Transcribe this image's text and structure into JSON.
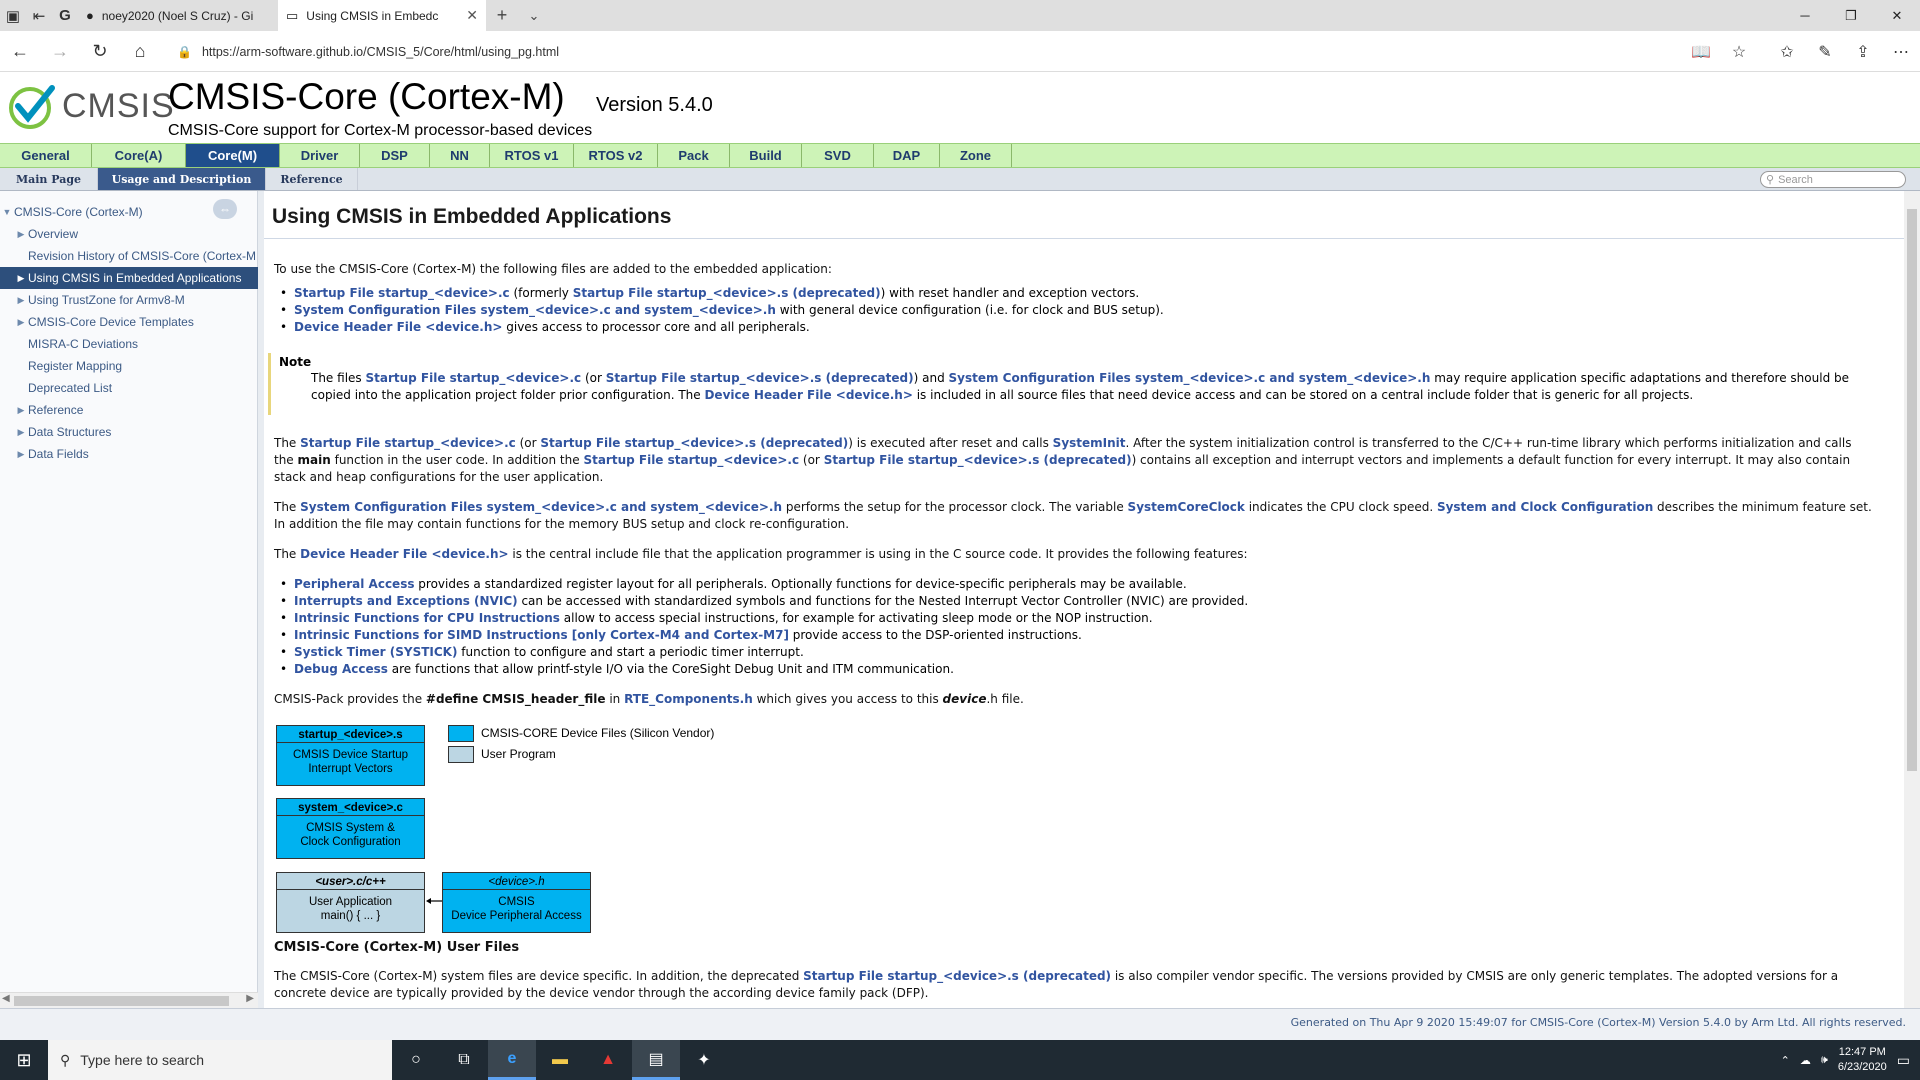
{
  "browser": {
    "tabs": [
      {
        "title": "noey2020 (Noel S Cruz) - Gi"
      },
      {
        "title": "Using CMSIS in Embedc"
      }
    ],
    "url": "https://arm-software.github.io/CMSIS_5/Core/html/using_pg.html"
  },
  "header": {
    "logo_text": "CMSIS",
    "title": "CMSIS-Core (Cortex-M)",
    "version": "Version 5.4.0",
    "brief": "CMSIS-Core support for Cortex-M processor-based devices"
  },
  "topnav": [
    "General",
    "Core(A)",
    "Core(M)",
    "Driver",
    "DSP",
    "NN",
    "RTOS v1",
    "RTOS v2",
    "Pack",
    "Build",
    "SVD",
    "DAP",
    "Zone"
  ],
  "subnav": [
    "Main Page",
    "Usage and Description",
    "Reference"
  ],
  "search_placeholder": "Search",
  "sidebar": [
    {
      "label": "CMSIS-Core (Cortex-M)",
      "arrow": "▼"
    },
    {
      "label": "Overview",
      "arrow": "▶"
    },
    {
      "label": "Revision History of CMSIS-Core (Cortex-M",
      "arrow": ""
    },
    {
      "label": "Using CMSIS in Embedded Applications",
      "arrow": "▶"
    },
    {
      "label": "Using TrustZone for Armv8-M",
      "arrow": "▶"
    },
    {
      "label": "CMSIS-Core Device Templates",
      "arrow": "▶"
    },
    {
      "label": "MISRA-C Deviations",
      "arrow": ""
    },
    {
      "label": "Register Mapping",
      "arrow": ""
    },
    {
      "label": "Deprecated List",
      "arrow": ""
    },
    {
      "label": "Reference",
      "arrow": "▶"
    },
    {
      "label": "Data Structures",
      "arrow": "▶"
    },
    {
      "label": "Data Fields",
      "arrow": "▶"
    }
  ],
  "content": {
    "heading": "Using CMSIS in Embedded Applications",
    "intro": "To use the CMSIS-Core (Cortex-M) the following files are added to the embedded application:",
    "files": [
      {
        "link": "Startup File startup_<device>.c",
        "mid": " (formerly ",
        "link2": "Startup File startup_<device>.s (deprecated)",
        "rest": ") with reset handler and exception vectors."
      },
      {
        "link": "System Configuration Files system_<device>.c and system_<device>.h",
        "mid": "",
        "link2": "",
        "rest": " with general device configuration (i.e. for clock and BUS setup)."
      },
      {
        "link": "Device Header File <device.h>",
        "mid": "",
        "link2": "",
        "rest": " gives access to processor core and all peripherals."
      }
    ],
    "note_label": "Note",
    "note_parts": [
      "The files ",
      "Startup File startup_<device>.c",
      " (or ",
      "Startup File startup_<device>.s (deprecated)",
      ") and ",
      "System Configuration Files system_<device>.c and system_<device>.h",
      " may require application specific adaptations and therefore should be copied into the application project folder prior configuration. The ",
      "Device Header File <device.h>",
      " is included in all source files that need device access and can be stored on a central include folder that is generic for all projects."
    ],
    "p1_parts": [
      "The ",
      "Startup File startup_<device>.c",
      " (or ",
      "Startup File startup_<device>.s (deprecated)",
      ") is executed after reset and calls ",
      "SystemInit",
      ". After the system initialization control is transferred to the C/C++ run-time library which performs initialization and calls the ",
      "main",
      " function in the user code. In addition the ",
      "Startup File startup_<device>.c",
      " (or ",
      "Startup File startup_<device>.s (deprecated)",
      ") contains all exception and interrupt vectors and implements a default function for every interrupt. It may also contain stack and heap configurations for the user application."
    ],
    "p2_parts": [
      "The ",
      "System Configuration Files system_<device>.c and system_<device>.h",
      " performs the setup for the processor clock. The variable ",
      "SystemCoreClock",
      " indicates the CPU clock speed. ",
      "System and Clock Configuration",
      " describes the minimum feature set. In addition the file may contain functions for the memory BUS setup and clock re-configuration."
    ],
    "p3_parts": [
      "The ",
      "Device Header File <device.h>",
      " is the central include file that the application programmer is using in the C source code. It provides the following features:"
    ],
    "features": [
      {
        "link": "Peripheral Access",
        "rest": " provides a standardized register layout for all peripherals. Optionally functions for device-specific peripherals may be available."
      },
      {
        "link": "Interrupts and Exceptions (NVIC)",
        "rest": " can be accessed with standardized symbols and functions for the Nested Interrupt Vector Controller (NVIC) are provided."
      },
      {
        "link": "Intrinsic Functions for CPU Instructions",
        "rest": " allow to access special instructions, for example for activating sleep mode or the NOP instruction."
      },
      {
        "link": "Intrinsic Functions for SIMD Instructions [only Cortex-M4 and Cortex-M7]",
        "rest": " provide access to the DSP-oriented instructions."
      },
      {
        "link": "Systick Timer (SYSTICK)",
        "rest": " function to configure and start a periodic timer interrupt."
      },
      {
        "link": "Debug Access",
        "rest": " are functions that allow printf-style I/O via the CoreSight Debug Unit and ITM communication."
      }
    ],
    "pack_parts": [
      "CMSIS-Pack provides the ",
      "#define CMSIS_header_file",
      " in ",
      "RTE_Components.h",
      " which gives you access to this ",
      "device",
      ".h file."
    ],
    "diagram": {
      "startup_head": "startup_<device>.s",
      "startup_body": "CMSIS Device Startup\nInterrupt Vectors",
      "system_head": "system_<device>.c",
      "system_body": "CMSIS System &\nClock Configuration",
      "user_head": "<user>.c/c++",
      "user_body": "User Application\nmain() { ... }",
      "device_head": "<device>.h",
      "device_body": "CMSIS\nDevice Peripheral Access",
      "legend_vendor": "CMSIS-CORE Device Files (Silicon Vendor)",
      "legend_user": "User Program"
    },
    "caption": "CMSIS-Core (Cortex-M) User Files",
    "p4_parts": [
      "The CMSIS-Core (Cortex-M) system files are device specific. In addition, the deprecated ",
      "Startup File startup_<device>.s (deprecated)",
      " is also compiler vendor specific. The versions provided by CMSIS are only generic templates. The adopted versions for a concrete device are typically provided by the device vendor through the according device family pack (DFP)."
    ]
  },
  "footer": "Generated on Thu Apr 9 2020 15:49:07 for CMSIS-Core (Cortex-M) Version 5.4.0 by Arm Ltd. All rights reserved.",
  "taskbar": {
    "search_placeholder": "Type here to search",
    "time": "12:47 PM",
    "date": "6/23/2020"
  },
  "colors": {
    "link": "#3154a0",
    "topnav_bg": "#cdf3b7",
    "selected_nav": "#1f4e8c",
    "device_file": "#00b2f0",
    "user_file": "#bcd6e3"
  }
}
